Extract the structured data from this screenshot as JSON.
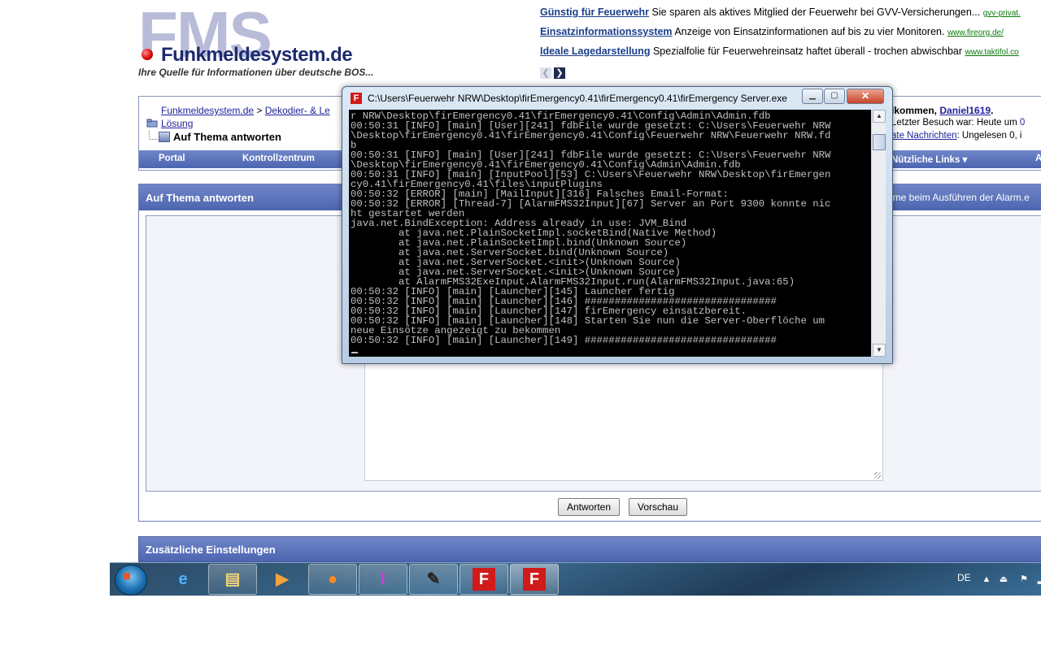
{
  "header": {
    "logo_bg": "FMS",
    "logo_name": "Funkmeldesystem.de",
    "logo_tagline": "Ihre Quelle für Informationen über deutsche BOS..."
  },
  "ads": [
    {
      "title": "Günstig für Feuerwehr",
      "text": "Sie sparen als aktives Mitglied der Feuerwehr bei GVV-Versicherungen...",
      "url": "gvv-privat."
    },
    {
      "title": "Einsatzinformationssystem",
      "text": "Anzeige von Einsatzinformationen auf bis zu vier Monitoren.",
      "url": "www.fireorg.de/"
    },
    {
      "title": "Ideale Lagedarstellung",
      "text": "Spezialfolie für Feuerwehreinsatz haftet überall - trochen abwischbar",
      "url": "www.taktifol.co"
    }
  ],
  "breadcrumb": {
    "home": "Funkmeldesystem.de",
    "sep": ">",
    "section": "Dekodier- & Le",
    "line2": "Lösung",
    "current": "Auf Thema antworten"
  },
  "user": {
    "welcome": "lkommen,",
    "name": "Daniel1619",
    "welcome_end": ".",
    "last_visit": "Letzter Besuch war: Heute um",
    "last_visit_val": "0",
    "pm_link": "ate Nachrichten",
    "pm_text": ": Ungelesen 0, i"
  },
  "navbar": {
    "portal": "Portal",
    "kontrollzentrum": "Kontrollzentrum",
    "links": "Nützliche Links ▾",
    "more": "A"
  },
  "reply": {
    "title": "Auf Thema antworten",
    "note": "eme beim Ausführen der Alarm.e",
    "submit": "Antworten",
    "preview": "Vorschau"
  },
  "extra": {
    "title": "Zusätzliche Einstellungen"
  },
  "console": {
    "title": "C:\\Users\\Feuerwehr NRW\\Desktop\\firEmergency0.41\\firEmergency0.41\\firEmergency Server.exe",
    "icon_letter": "F",
    "text": "r NRW\\Desktop\\firEmergency0.41\\firEmergency0.41\\Config\\Admin\\Admin.fdb\n00:50:31 [INFO] [main] [User][241] fdbFile wurde gesetzt: C:\\Users\\Feuerwehr NRW\n\\Desktop\\firEmergency0.41\\firEmergency0.41\\Config\\Feuerwehr NRW\\Feuerwehr NRW.fd\nb\n00:50:31 [INFO] [main] [User][241] fdbFile wurde gesetzt: C:\\Users\\Feuerwehr NRW\n\\Desktop\\firEmergency0.41\\firEmergency0.41\\Config\\Admin\\Admin.fdb\n00:50:31 [INFO] [main] [InputPool][53] C:\\Users\\Feuerwehr NRW\\Desktop\\firEmergen\ncy0.41\\firEmergency0.41\\files\\inputPlugins\n00:50:32 [ERROR] [main] [MailInput][316] Falsches Email-Format:\n00:50:32 [ERROR] [Thread-7] [AlarmFMS32Input][67] Server an Port 9300 konnte nic\nht gestartet werden\njava.net.BindException: Address already in use: JVM_Bind\n        at java.net.PlainSocketImpl.socketBind(Native Method)\n        at java.net.PlainSocketImpl.bind(Unknown Source)\n        at java.net.ServerSocket.bind(Unknown Source)\n        at java.net.ServerSocket.<init>(Unknown Source)\n        at java.net.ServerSocket.<init>(Unknown Source)\n        at AlarmFMS32ExeInput.AlarmFMS32Input.run(AlarmFMS32Input.java:65)\n00:50:32 [INFO] [main] [Launcher][145] Launcher fertig\n00:50:32 [INFO] [main] [Launcher][146] ################################\n00:50:32 [INFO] [main] [Launcher][147] firEmergency einsatzbereit.\n00:50:32 [INFO] [main] [Launcher][148] Starten Sie nun die Server-Oberflöche um\nneue Einsötze angezeigt zu bekommen\n00:50:32 [INFO] [main] [Launcher][149] ################################"
  },
  "taskbar": {
    "tasks": [
      {
        "name": "ie-icon",
        "glyph": "e"
      },
      {
        "name": "explorer-icon",
        "glyph": "▤"
      },
      {
        "name": "media-player-icon",
        "glyph": "▶"
      },
      {
        "name": "firefox-icon",
        "glyph": "●"
      },
      {
        "name": "app-icon",
        "glyph": "ⵏ"
      },
      {
        "name": "tool-icon",
        "glyph": "✎"
      },
      {
        "name": "firemergency-icon",
        "glyph": "F"
      },
      {
        "name": "firemergency-server-icon",
        "glyph": "F"
      }
    ],
    "lang": "DE"
  }
}
